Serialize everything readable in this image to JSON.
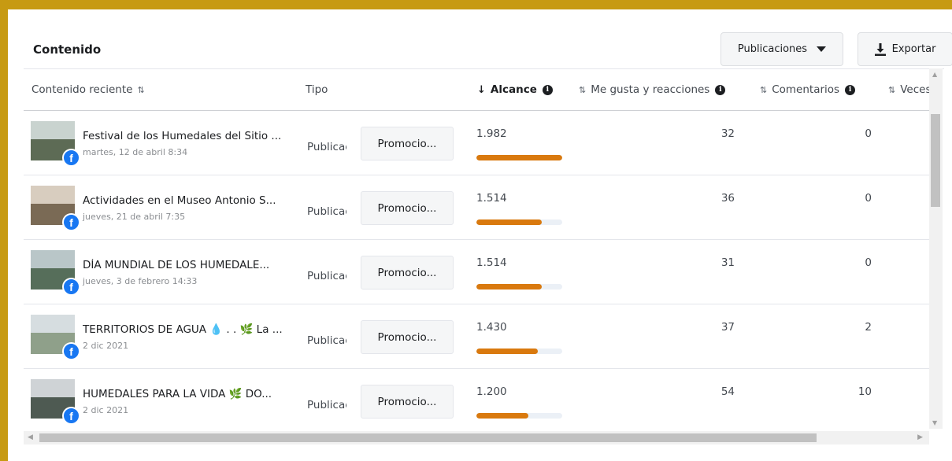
{
  "header": {
    "title": "Contenido",
    "publicaciones_label": "Publicaciones",
    "exportar_label": "Exportar"
  },
  "columns": {
    "contenido": "Contenido reciente",
    "tipo": "Tipo",
    "alcance": "Alcance",
    "reacciones": "Me gusta y reacciones",
    "comentarios": "Comentarios",
    "veces": "Veces"
  },
  "sort_arrows": "⇅",
  "rows": [
    {
      "title": "Festival de los Humedales del Sitio ...",
      "date": "martes, 12 de abril 8:34",
      "tipo": "Publicación",
      "promo": "Promocio...",
      "alcance": "1.982",
      "reach_value": 1982,
      "likes": "32",
      "comentarios": "0",
      "thumb_colors": {
        "sky": "#c9d3cf",
        "ground": "#5d6b55"
      }
    },
    {
      "title": "Actividades en el Museo Antonio S...",
      "date": "jueves, 21 de abril 7:35",
      "tipo": "Publicación",
      "promo": "Promocio...",
      "alcance": "1.514",
      "reach_value": 1514,
      "likes": "36",
      "comentarios": "0",
      "thumb_colors": {
        "sky": "#d8cdbf",
        "ground": "#7a6a55"
      }
    },
    {
      "title": "DÍA MUNDIAL DE LOS HUMEDALE...",
      "date": "jueves, 3 de febrero 14:33",
      "tipo": "Publicación",
      "promo": "Promocio...",
      "alcance": "1.514",
      "reach_value": 1514,
      "likes": "31",
      "comentarios": "0",
      "thumb_colors": {
        "sky": "#b9c6c8",
        "ground": "#566e5a"
      }
    },
    {
      "title": "TERRITORIOS DE AGUA 💧 . . 🌿 La ...",
      "date": "2 dic 2021",
      "tipo": "Publicación",
      "promo": "Promocio...",
      "alcance": "1.430",
      "reach_value": 1430,
      "likes": "37",
      "comentarios": "2",
      "thumb_colors": {
        "sky": "#d6dde0",
        "ground": "#8fa08a"
      }
    },
    {
      "title": "HUMEDALES PARA LA VIDA 🌿 DO...",
      "date": "2 dic 2021",
      "tipo": "Publicación",
      "promo": "Promocio...",
      "alcance": "1.200",
      "reach_value": 1200,
      "likes": "54",
      "comentarios": "10",
      "thumb_colors": {
        "sky": "#cfd3d6",
        "ground": "#4e5a52"
      }
    }
  ],
  "reach_max": 1982,
  "colors": {
    "accent_bar": "#d9790e",
    "frame": "#c79a12",
    "facebook": "#1877f2"
  }
}
